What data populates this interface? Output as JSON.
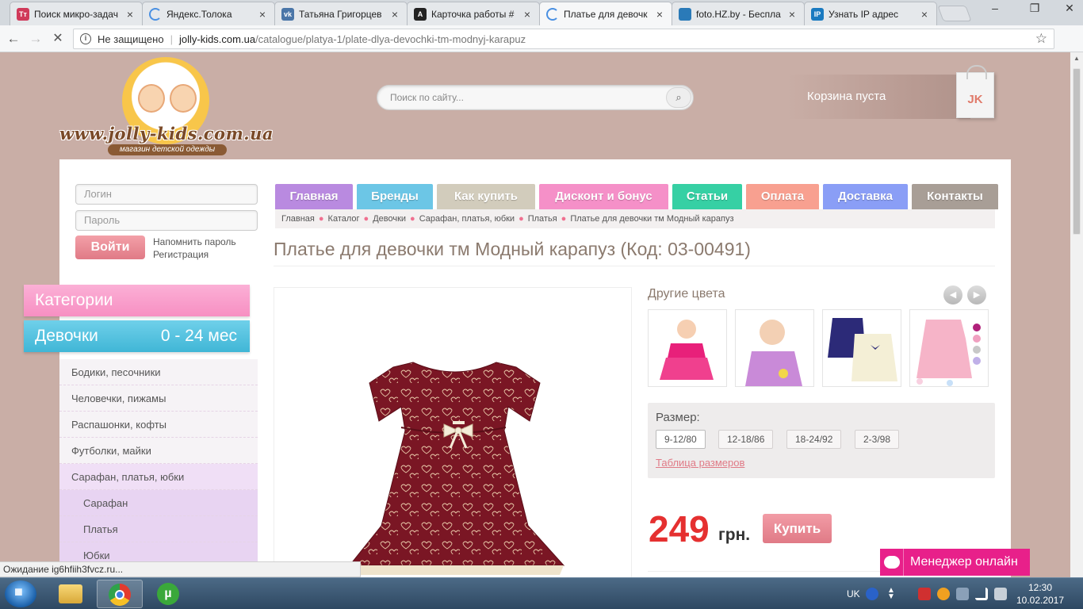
{
  "browser": {
    "tabs": [
      {
        "title": "Поиск микро-задач",
        "favicon": "toloka-t-icon",
        "favicon_text": "Тт",
        "color": "#d03a5a",
        "active": false
      },
      {
        "title": "Яндекс.Толока",
        "favicon": "loading-spinner-icon",
        "color": "#4a90e2",
        "active": false
      },
      {
        "title": "Татьяна Григорцев",
        "favicon": "vk-icon",
        "favicon_text": "vk",
        "color": "#4a76a8",
        "active": false
      },
      {
        "title": "Карточка работы #",
        "favicon": "a-letter-icon",
        "favicon_text": "A",
        "color": "#222222",
        "active": false
      },
      {
        "title": "Платье для девочк",
        "favicon": "loading-spinner-icon",
        "color": "#4a90e2",
        "active": true
      },
      {
        "title": "foto.HZ.by - Беспла",
        "favicon": "globe-icon",
        "color": "#2a7ab8",
        "active": false
      },
      {
        "title": "Узнать IP адрес",
        "favicon": "ip-icon",
        "favicon_text": "IP",
        "color": "#1a7ac0",
        "active": false
      }
    ],
    "address": {
      "security_label": "Не защищено",
      "host": "jolly-kids.com.ua",
      "path": "/catalogue/platya-1/plate-dlya-devochki-tm-modnyj-karapuz"
    },
    "status_text": "Ожидание ig6hfiih3fvcz.ru..."
  },
  "site": {
    "logo": {
      "domain": "www.jolly-kids.com.ua",
      "tagline": "магазин детской одежды"
    },
    "search_placeholder": "Поиск по сайту...",
    "cart_label": "Корзина пуста",
    "cart_badge": "JK",
    "login": {
      "login_placeholder": "Логин",
      "password_placeholder": "Пароль",
      "button": "Войти",
      "remind_link": "Напомнить пароль",
      "register_link": "Регистрация"
    },
    "categories_heading": "Категории",
    "section": {
      "name": "Девочки",
      "age": "0 - 24 мес"
    },
    "sidebar": [
      {
        "label": "Бодики, песочники",
        "kind": "item"
      },
      {
        "label": "Человечки, пижамы",
        "kind": "item"
      },
      {
        "label": "Распашонки, кофты",
        "kind": "item"
      },
      {
        "label": "Футболки, майки",
        "kind": "item"
      },
      {
        "label": "Сарафан, платья, юбки",
        "kind": "active"
      },
      {
        "label": "Сарафан",
        "kind": "sub"
      },
      {
        "label": "Платья",
        "kind": "sub"
      },
      {
        "label": "Юбки",
        "kind": "sub"
      }
    ],
    "menu": [
      {
        "label": "Главная",
        "color": "#b98ae0"
      },
      {
        "label": "Бренды",
        "color": "#6cc6e6"
      },
      {
        "label": "Как купить",
        "color": "#d2ccbc"
      },
      {
        "label": "Дисконт и бонус",
        "color": "#f590c8"
      },
      {
        "label": "Статьи",
        "color": "#36d0a4"
      },
      {
        "label": "Оплата",
        "color": "#f8a090"
      },
      {
        "label": "Доставка",
        "color": "#8a9ef6"
      },
      {
        "label": "Контакты",
        "color": "#a89e96"
      }
    ],
    "breadcrumbs": [
      "Главная",
      "Каталог",
      "Девочки",
      "Сарафан, платья, юбки",
      "Платья",
      "Платье для девочки тм Модный карапуз"
    ],
    "product": {
      "title": "Платье для девочки тм Модный карапуз (Код: 03-00491)",
      "other_colors_label": "Другие цвета",
      "size_label": "Размер:",
      "sizes": [
        "9-12/80",
        "12-18/86",
        "18-24/92",
        "2-3/98"
      ],
      "selected_size": "9-12/80",
      "size_table_link": "Таблица размеров",
      "price": "249",
      "currency": "грн.",
      "buy_button": "Купить"
    },
    "chat_label": "Менеджер онлайн"
  },
  "taskbar": {
    "lang": "UK",
    "time": "12:30",
    "date": "10.02.2017"
  }
}
